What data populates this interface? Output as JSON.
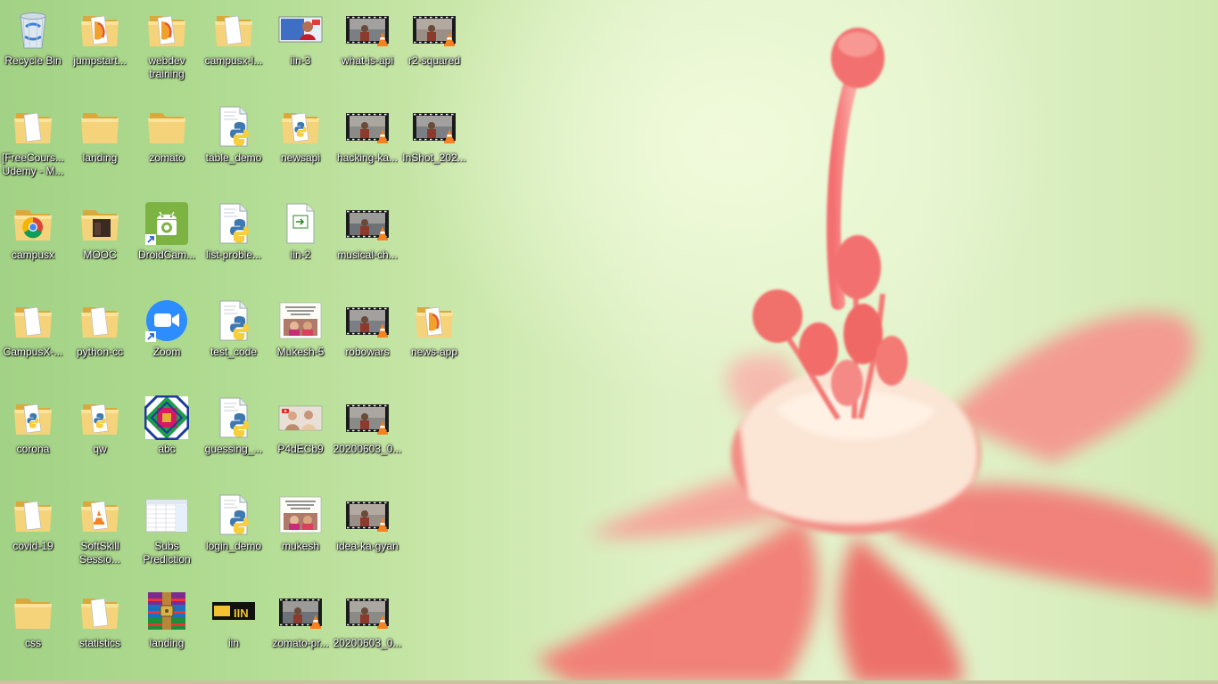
{
  "desktop": {
    "icons": [
      {
        "label": "Recycle Bin",
        "type": "recycle-bin"
      },
      {
        "label": "jumpstart...",
        "type": "folder-color"
      },
      {
        "label": "webdev training",
        "type": "folder-color"
      },
      {
        "label": "campusx-l...",
        "type": "folder-doc"
      },
      {
        "label": "iin-3",
        "type": "image-thumb"
      },
      {
        "label": "what-is-api",
        "type": "video-vlc"
      },
      {
        "label": "r2-squared",
        "type": "video-vlc"
      },
      {
        "label": "[FreeCours... Udemy - M...",
        "type": "folder-doc"
      },
      {
        "label": "landing",
        "type": "folder"
      },
      {
        "label": "zomato",
        "type": "folder"
      },
      {
        "label": "table_demo",
        "type": "python"
      },
      {
        "label": "newsapi",
        "type": "folder-python"
      },
      {
        "label": "hacking-ka...",
        "type": "video-vlc"
      },
      {
        "label": "InShot_202...",
        "type": "video-vlc"
      },
      {
        "label": "campusx",
        "type": "folder-chrome"
      },
      {
        "label": "MOOC",
        "type": "folder-dark"
      },
      {
        "label": "DroidCam...",
        "type": "droidcam"
      },
      {
        "label": "list-proble...",
        "type": "python"
      },
      {
        "label": "iin-2",
        "type": "html-file"
      },
      {
        "label": "musical-ch...",
        "type": "video-vlc"
      },
      {
        "label": "CampusX-...",
        "type": "folder-doc"
      },
      {
        "label": "python-cc",
        "type": "folder-doc"
      },
      {
        "label": "Zoom",
        "type": "zoom"
      },
      {
        "label": "test_code",
        "type": "python"
      },
      {
        "label": "Mukesh-5",
        "type": "image-thumb2"
      },
      {
        "label": "robowars",
        "type": "video-vlc"
      },
      {
        "label": "news-app",
        "type": "folder-color"
      },
      {
        "label": "corona",
        "type": "folder-python"
      },
      {
        "label": "qw",
        "type": "folder-python"
      },
      {
        "label": "abc",
        "type": "abc-image"
      },
      {
        "label": "guessing_...",
        "type": "python"
      },
      {
        "label": "P4dECb9",
        "type": "image-thumb3"
      },
      {
        "label": "20200603_0...",
        "type": "video-vlc"
      },
      {
        "label": "covid-19",
        "type": "folder-doc"
      },
      {
        "label": "SoftSkill Sessio...",
        "type": "folder-vlc"
      },
      {
        "label": "Subs Prediction",
        "type": "spreadsheet"
      },
      {
        "label": "login_demo",
        "type": "python"
      },
      {
        "label": "mukesh",
        "type": "image-thumb2"
      },
      {
        "label": "idea-ka-gyan",
        "type": "video-vlc"
      },
      {
        "label": "css",
        "type": "folder"
      },
      {
        "label": "statistics",
        "type": "folder-doc"
      },
      {
        "label": "landing",
        "type": "winrar"
      },
      {
        "label": "iin",
        "type": "iin-logo"
      },
      {
        "label": "zomato-pr...",
        "type": "video-vlc"
      },
      {
        "label": "20200603_0...",
        "type": "video-vlc"
      }
    ]
  }
}
